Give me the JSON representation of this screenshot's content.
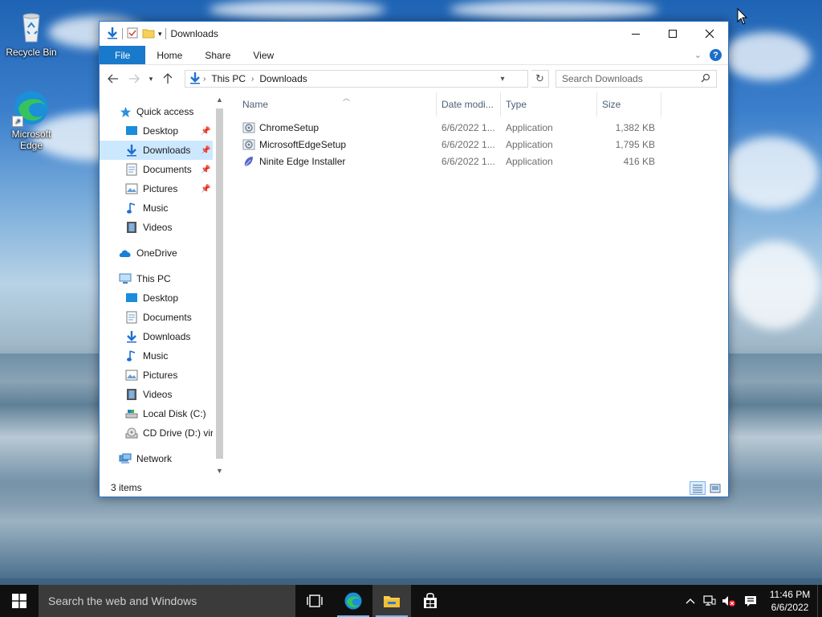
{
  "desktop": {
    "icons": [
      {
        "label": "Recycle Bin"
      },
      {
        "label": "Microsoft Edge"
      }
    ]
  },
  "window": {
    "title": "Downloads",
    "controls": {
      "minimize": "—",
      "maximize": "☐",
      "close": "✕"
    },
    "ribbon_tabs": [
      "File",
      "Home",
      "Share",
      "View"
    ],
    "address": {
      "crumbs": [
        "This PC",
        "Downloads"
      ]
    },
    "search": {
      "placeholder": "Search Downloads"
    },
    "nav_pane": {
      "quick_access": "Quick access",
      "quick_items": [
        {
          "label": "Desktop",
          "pinned": true
        },
        {
          "label": "Downloads",
          "pinned": true,
          "selected": true
        },
        {
          "label": "Documents",
          "pinned": true
        },
        {
          "label": "Pictures",
          "pinned": true
        },
        {
          "label": "Music"
        },
        {
          "label": "Videos"
        }
      ],
      "onedrive": "OneDrive",
      "this_pc": "This PC",
      "pc_items": [
        {
          "label": "Desktop"
        },
        {
          "label": "Documents"
        },
        {
          "label": "Downloads"
        },
        {
          "label": "Music"
        },
        {
          "label": "Pictures"
        },
        {
          "label": "Videos"
        },
        {
          "label": "Local Disk (C:)"
        },
        {
          "label": "CD Drive (D:) virt"
        }
      ],
      "network": "Network"
    },
    "columns": {
      "name": "Name",
      "date": "Date modi...",
      "type": "Type",
      "size": "Size"
    },
    "files": [
      {
        "name": "ChromeSetup",
        "date": "6/6/2022 1...",
        "type": "Application",
        "size": "1,382 KB",
        "icon": "chrome-setup-icon"
      },
      {
        "name": "MicrosoftEdgeSetup",
        "date": "6/6/2022 1...",
        "type": "Application",
        "size": "1,795 KB",
        "icon": "edge-setup-icon"
      },
      {
        "name": "Ninite Edge Installer",
        "date": "6/6/2022 1...",
        "type": "Application",
        "size": "416 KB",
        "icon": "ninite-icon"
      }
    ],
    "status": {
      "items": "3 items"
    }
  },
  "taskbar": {
    "search_placeholder": "Search the web and Windows",
    "apps": [
      "task-view",
      "microsoft-edge",
      "file-explorer",
      "store"
    ],
    "clock": {
      "time": "11:46 PM",
      "date": "6/6/2022"
    }
  },
  "colors": {
    "accent": "#1979ca",
    "selection": "#cce8ff",
    "taskbar": "#101010"
  }
}
